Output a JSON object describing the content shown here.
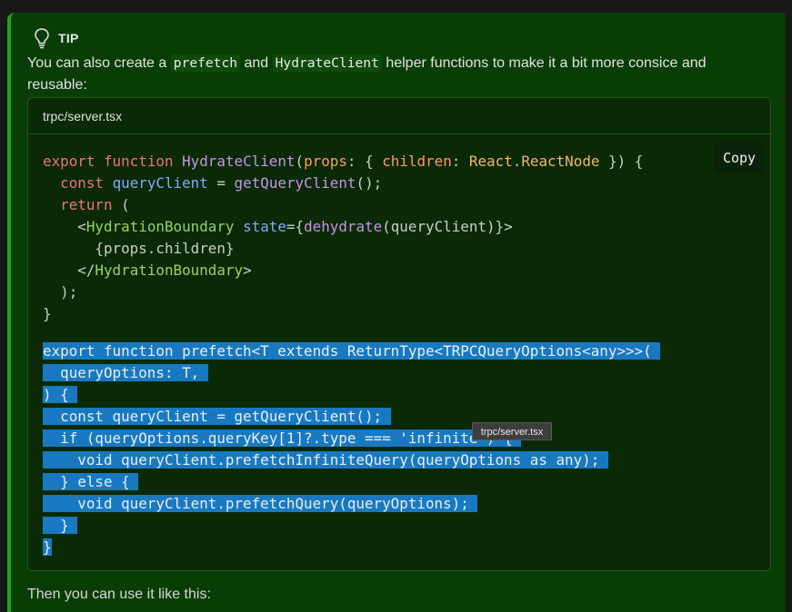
{
  "tip": {
    "title": "TIP",
    "text_before": "You can also create a ",
    "code1": "prefetch",
    "text_mid": " and ",
    "code2": "HydrateClient",
    "text_after": " helper functions to make it a bit more consice and reusable:"
  },
  "codeblock": {
    "filename": "trpc/server.tsx",
    "copy_label": "Copy"
  },
  "tooltip": "trpc/server.tsx",
  "below_text": "Then you can use it like this:",
  "colors": {
    "tip_bg": "#093d06",
    "tip_border": "#21a31a",
    "selection": "#1979c0"
  },
  "icons": {
    "tip": "lightbulb-icon"
  }
}
